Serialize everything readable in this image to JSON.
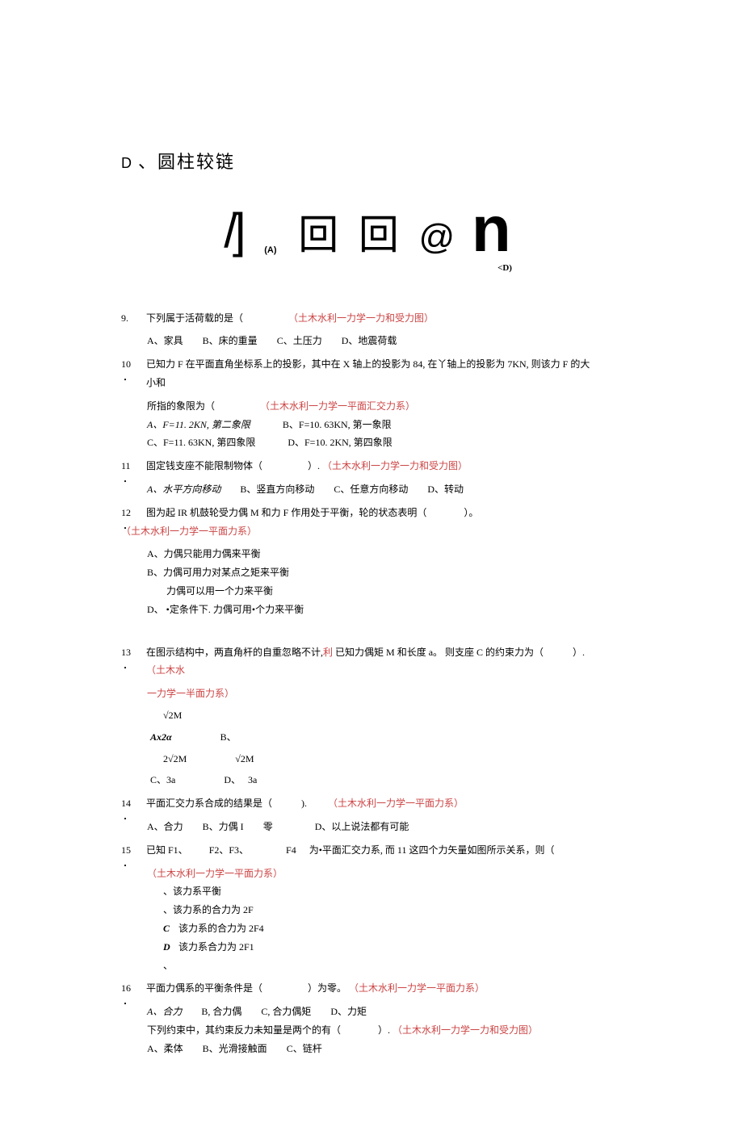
{
  "optD": {
    "letter": "D",
    "sep": "、",
    "text": "圆柱较链"
  },
  "glyphs": {
    "slash": "/",
    "bracket": "]",
    "subA": "(A)",
    "box1": "回",
    "box2": "回",
    "at": "@",
    "n": "n",
    "subD": "<D)"
  },
  "q9": {
    "num": "9.",
    "stem": "下列属于活荷载的是（",
    "tag": "（土木水利一力学一力和受力图）",
    "opts": {
      "a": "A、家具",
      "b": "B、床的重量",
      "c": "C、土压力",
      "d": "D、地震荷载"
    }
  },
  "q10": {
    "num": "10",
    "dot": "・",
    "stem1": "已知力 F 在平面直角坐标系上的投影，其中在 X 轴上的投影为 84, 在丫轴上的投影为 7KN, 则该力 F 的大小和",
    "stem2": "所指的象限为（",
    "tag": "（土木水利一力学一平面汇交力系）",
    "opts": {
      "a": "A、F=11. 2KN, 第二象限",
      "b": "B、F=10. 63KN, 第一象限",
      "c": "C、F=11. 63KN, 第四象限",
      "d": "D、F=10. 2KN, 第四象限"
    }
  },
  "q11": {
    "num": "11",
    "dot": "・",
    "stem": "固定钱支座不能限制物体（",
    "close": "）.",
    "tag": "（土木水利一力学一力和受力图）",
    "opts": {
      "a": "A、水平方向移动",
      "b": "B、竖直方向移动",
      "c": "C、任意方向移动",
      "d": "D、转动"
    }
  },
  "q12": {
    "num": "12",
    "dot": "・",
    "stem": "图为起 IR 机鼓轮受力偶 M 和力 F 作用处于平衡，轮的状态表明（",
    "close": "）。",
    "tag": "（土木水利一力学一平面力系）",
    "opts": {
      "a": "A、力偶只能用力偶来平衡",
      "b": "B、力偶可用力对某点之矩来平衡",
      "c": "力偶可以用一个力来平衡",
      "d": "D、 •定条件下. 力偶可用•个力来平衡"
    }
  },
  "q13": {
    "num": "13",
    "dot": "・",
    "stem1": "在图示结构中，两直角杆的自重忽略不计,",
    "stemRed": "利",
    "stem2": " 已知力偶矩 M 和长度 a。 则支座 C 的约束力为（",
    "close": "）.",
    "tag": "（土木水",
    "tag2": "一力学一半面力系）",
    "r1a": "√2M",
    "r2a": "Ax2α",
    "r2b": "B、",
    "r3a": "2√2M",
    "r3b": "√2M",
    "r4a": "C、3a",
    "r4b": "D、",
    "r4c": "3a"
  },
  "q14": {
    "num": "14",
    "dot": "・",
    "stem": "平面汇交力系合成的结果是（",
    "close": ").",
    "tag": "（土木水利一力学一平面力系）",
    "opts": {
      "a": "A、合力",
      "b": "B、力偶 I",
      "c": "零",
      "d": "D、以上说法都有可能"
    }
  },
  "q15": {
    "num": "15",
    "dot": "・",
    "stem1a": "已知 F1、",
    "stem1b": "F2、F3、",
    "stem1c": "F4",
    "stem1d": "为•平面汇交力系, 而 11 这四个力矢量如图所示关系，则（",
    "tag": "（土木水利一力学一平面力系）",
    "opts": {
      "a": "、该力系平衡",
      "b": "、该力系的合力为 2F",
      "cLabel": "C",
      "c": "该力系的合力为 2F4",
      "dLabel": "D",
      "d": "该力系合力为 2F1",
      "e": "、"
    }
  },
  "q16": {
    "num": "16",
    "dot": "・",
    "stem": "平面力偶系的平衡条件是（",
    "close": "）为零。",
    "tag": "（土木水利一力学一平面力系）",
    "opts": {
      "a": "A、合力",
      "b": "B, 合力偶",
      "c": "C, 合力偶矩",
      "d": "D、力矩"
    },
    "sub": {
      "stem": "下列约束中，其约束反力未知量是两个的有（",
      "close": "）.",
      "tag": "（土木水利一力学一力和受力图）",
      "opts": {
        "a": "A、柔体",
        "b": "B、光滑接触面",
        "c": "C、链杆"
      }
    }
  }
}
